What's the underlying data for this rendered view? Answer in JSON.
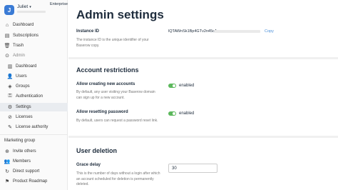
{
  "user": {
    "initial": "J",
    "name": "Juliet",
    "caret": "▾"
  },
  "workspace_badge": "Enterprise",
  "nav": {
    "top": [
      {
        "key": "dashboard",
        "label": "Dashboard",
        "icon": "dashboard-icon"
      },
      {
        "key": "subscriptions",
        "label": "Subscriptions",
        "icon": "subscriptions-icon"
      },
      {
        "key": "trash",
        "label": "Trash",
        "icon": "trash-icon"
      },
      {
        "key": "admin",
        "label": "Admin",
        "icon": "admin-icon"
      }
    ],
    "admin": [
      {
        "key": "admin-dashboard",
        "label": "Dashboard"
      },
      {
        "key": "users",
        "label": "Users"
      },
      {
        "key": "groups",
        "label": "Groups"
      },
      {
        "key": "authentication",
        "label": "Authentication"
      },
      {
        "key": "settings",
        "label": "Settings"
      },
      {
        "key": "licenses",
        "label": "Licenses"
      },
      {
        "key": "license-authority",
        "label": "License authority"
      }
    ],
    "marketing_title": "Marketing group",
    "bottom": [
      {
        "key": "invite",
        "label": "Invite others"
      },
      {
        "key": "members",
        "label": "Members"
      },
      {
        "key": "support",
        "label": "Direct support"
      },
      {
        "key": "roadmap",
        "label": "Product Roadmap"
      }
    ]
  },
  "page": {
    "title": "Admin settings",
    "instance": {
      "label": "Instance ID",
      "description": "The instance ID is the unique identifier of your Baserow copy.",
      "value": "lQTAWnSk1Bp4GTv2n45cA",
      "copy_label": "Copy"
    },
    "account_restrictions": {
      "title": "Account restrictions",
      "allow_new_accounts": {
        "label": "Allow creating new accounts",
        "description": "By default, any user visiting your Baserow domain can sign up for a new account.",
        "status": "enabled"
      },
      "allow_reset_password": {
        "label": "Allow resetting password",
        "description": "By default, users can request a password reset link.",
        "status": "enabled"
      }
    },
    "user_deletion": {
      "title": "User deletion",
      "grace_delay": {
        "label": "Grace delay",
        "description": "This is the number of days without a login after which an account scheduled for deletion is permanently deleted.",
        "value": "30"
      }
    }
  },
  "colors": {
    "toggle_on": "#5cb85c",
    "link": "#4a90d9",
    "avatar": "#3a7bd5"
  }
}
